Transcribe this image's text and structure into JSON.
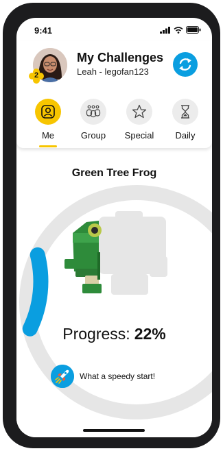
{
  "status_bar": {
    "time": "9:41"
  },
  "header": {
    "title": "My Challenges",
    "subtitle": "Leah - legofan123",
    "badge_count": "2"
  },
  "tabs": [
    {
      "label": "Me",
      "icon": "person-icon",
      "active": true
    },
    {
      "label": "Group",
      "icon": "group-icon",
      "active": false
    },
    {
      "label": "Special",
      "icon": "star-icon",
      "active": false
    },
    {
      "label": "Daily",
      "icon": "hourglass-icon",
      "active": false
    }
  ],
  "challenge": {
    "name": "Green Tree Frog",
    "progress_label": "Progress:",
    "progress_value": "22%",
    "progress_fraction": 0.22,
    "message": "What a speedy start!"
  },
  "colors": {
    "accent_yellow": "#f7c500",
    "accent_blue": "#0a9ee0",
    "brick_green": "#2e8b3a",
    "ghost_gray": "#e6e6e6"
  }
}
